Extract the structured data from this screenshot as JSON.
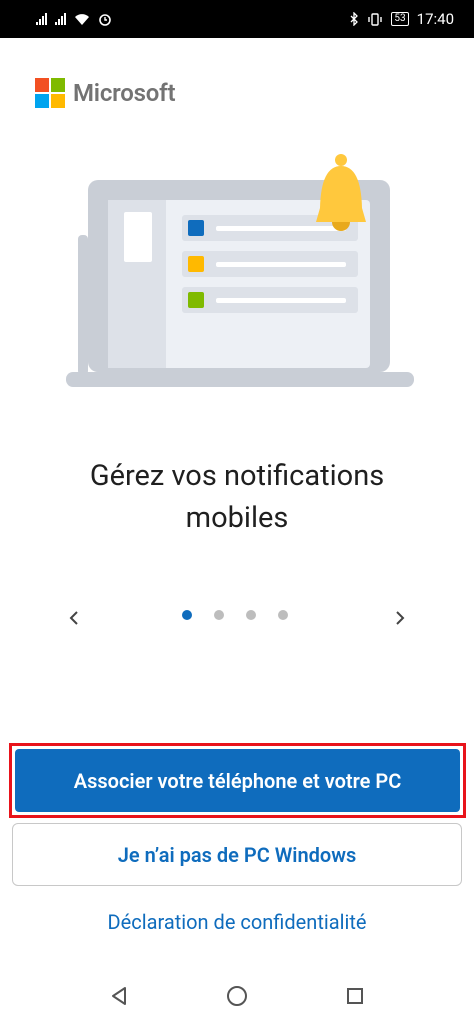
{
  "status_bar": {
    "battery": "53",
    "time": "17:40"
  },
  "logo": {
    "text": "Microsoft",
    "colors": [
      "#f25022",
      "#7fba00",
      "#00a4ef",
      "#ffb900"
    ]
  },
  "headline": {
    "line1": "Gérez vos notifications",
    "line2": "mobiles"
  },
  "pager": {
    "total": 4,
    "active_index": 0,
    "prev_icon": "chevron-left-icon",
    "next_icon": "chevron-right-icon"
  },
  "buttons": {
    "primary": "Associer votre téléphone et votre PC",
    "secondary": "Je n’ai pas de PC Windows"
  },
  "links": {
    "privacy": "Déclaration de confidentialité"
  },
  "colors": {
    "accent": "#0f6cbd",
    "highlight_border": "#e8131b",
    "bell": "#ffc83d"
  },
  "navigation": {
    "back_icon": "back-triangle-icon",
    "home_icon": "home-circle-icon",
    "recents_icon": "recents-square-icon"
  }
}
